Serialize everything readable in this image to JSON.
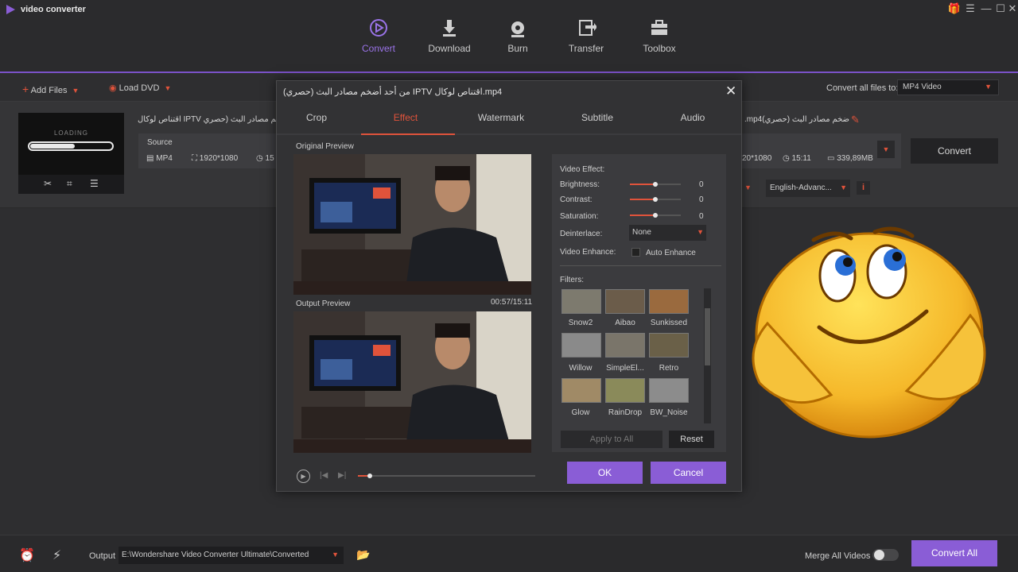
{
  "app": {
    "title": "video converter"
  },
  "window_controls": [
    "🎁",
    "☐",
    "—",
    "☐",
    "✕"
  ],
  "nav": [
    {
      "label": "Convert",
      "icon": "convert-icon",
      "active": true
    },
    {
      "label": "Download",
      "icon": "download-icon",
      "active": false
    },
    {
      "label": "Burn",
      "icon": "burn-icon",
      "active": false
    },
    {
      "label": "Transfer",
      "icon": "transfer-icon",
      "active": false
    },
    {
      "label": "Toolbox",
      "icon": "toolbox-icon",
      "active": false
    }
  ],
  "toolbar": {
    "add_files": "Add Files",
    "load_dvd": "Load DVD",
    "convert_to_label": "Convert all files to:",
    "convert_to_value": "MP4 Video"
  },
  "file": {
    "loading": "LOADING",
    "name_left": "اقتناص لوكال IPTV من أحد أضخم مصادر البث (حصري",
    "name_right": ".mp4(من أحد أضخم مصادر البث (حصري",
    "source_label": "Source",
    "format": "MP4",
    "resolution": "1920*1080",
    "duration_short": "15",
    "target_resolution": "20*1080",
    "target_duration": "15:11",
    "target_size": "339,89MB",
    "convert_label": "Convert",
    "subtitle_value": "English-Advanc..."
  },
  "dialog": {
    "title": "(من أحد أضخم مصادر البث (حصري IPTV اقتناص لوكال.mp4",
    "tabs": [
      "Crop",
      "Effect",
      "Watermark",
      "Subtitle",
      "Audio"
    ],
    "active_tab": "Effect",
    "original_preview": "Original Preview",
    "output_preview": "Output Preview",
    "time": "00:57/15:11",
    "video_effect": "Video Effect:",
    "brightness": {
      "label": "Brightness:",
      "value": "0"
    },
    "contrast": {
      "label": "Contrast:",
      "value": "0"
    },
    "saturation": {
      "label": "Saturation:",
      "value": "0"
    },
    "deinterlace": {
      "label": "Deinterlace:",
      "value": "None"
    },
    "video_enhance": {
      "label": "Video Enhance:",
      "option": "Auto Enhance"
    },
    "filters_label": "Filters:",
    "filters": [
      {
        "name": "Snow2",
        "color": "#7d7a6e"
      },
      {
        "name": "Aibao",
        "color": "#6b5c4a"
      },
      {
        "name": "Sunkissed",
        "color": "#9a6a3e"
      },
      {
        "name": "Willow",
        "color": "#8a8a8a"
      },
      {
        "name": "SimpleEl...",
        "color": "#7a756a"
      },
      {
        "name": "Retro",
        "color": "#6a6048"
      },
      {
        "name": "Glow",
        "color": "#a08a66"
      },
      {
        "name": "RainDrop",
        "color": "#8a8a5a"
      },
      {
        "name": "BW_Noise",
        "color": "#8c8c8c"
      }
    ],
    "apply_all": "Apply to All",
    "reset": "Reset",
    "ok": "OK",
    "cancel": "Cancel",
    "sliders": {
      "brightness": 0.5,
      "contrast": 0.5,
      "saturation": 0.5
    },
    "seek_fraction": 0.063
  },
  "bottom": {
    "output_label": "Output",
    "output_path": "E:\\Wondershare Video Converter Ultimate\\Converted",
    "merge_label": "Merge All Videos",
    "convert_all": "Convert All"
  },
  "colors": {
    "accent": "#8a5dd6",
    "highlight": "#e0533b"
  }
}
